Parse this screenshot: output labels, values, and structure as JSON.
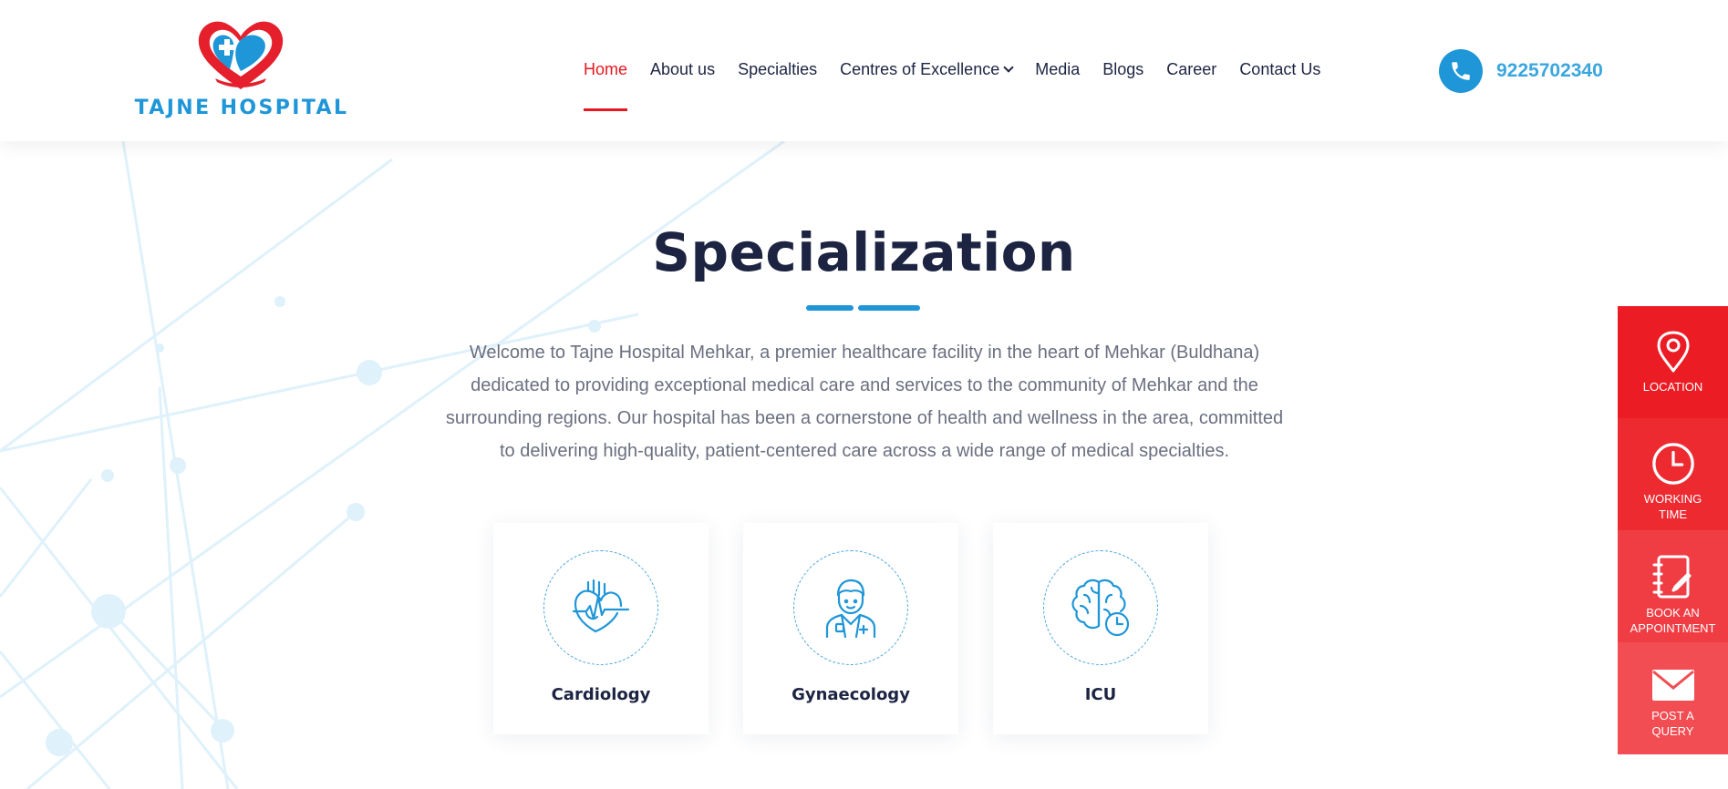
{
  "brand": {
    "name": "TAJNE HOSPITAL",
    "logo_icon": "heart-hands-cross-logo"
  },
  "nav": {
    "items": [
      {
        "label": "Home",
        "active": true
      },
      {
        "label": "About us"
      },
      {
        "label": "Specialties"
      },
      {
        "label": "Centres of Excellence",
        "has_dropdown": true
      },
      {
        "label": "Media"
      },
      {
        "label": "Blogs"
      },
      {
        "label": "Career"
      },
      {
        "label": "Contact Us"
      }
    ]
  },
  "contact": {
    "phone": "9225702340",
    "icon": "phone-icon"
  },
  "section": {
    "title": "Specialization",
    "intro": "Welcome to Tajne Hospital Mehkar, a premier healthcare facility in the heart of Mehkar (Buldhana) dedicated to providing exceptional medical care and services to the community of Mehkar and the surrounding regions. Our hospital has been a cornerstone of health and wellness in the area, committed to delivering high-quality, patient-centered care across a wide range of medical specialties."
  },
  "specialties": [
    {
      "label": "Cardiology",
      "icon": "heart-ecg-icon"
    },
    {
      "label": "Gynaecology",
      "icon": "doctor-icon"
    },
    {
      "label": "ICU",
      "icon": "brain-clock-icon"
    }
  ],
  "sidebar": {
    "items": [
      {
        "label": "LOCATION",
        "icon": "location-pin-icon",
        "color": "#ec1c24"
      },
      {
        "label": "WORKING\nTIME",
        "icon": "clock-icon",
        "color": "#ee2a31"
      },
      {
        "label": "BOOK AN\nAPPOINTMENT",
        "icon": "notebook-pen-icon",
        "color": "#f03d44"
      },
      {
        "label": "POST A\nQUERY",
        "icon": "envelope-icon",
        "color": "#f24d53"
      }
    ]
  },
  "colors": {
    "primary_blue": "#1f96d8",
    "accent_red": "#e8161f",
    "heading": "#1c2442",
    "body_text": "#6b6f80"
  }
}
